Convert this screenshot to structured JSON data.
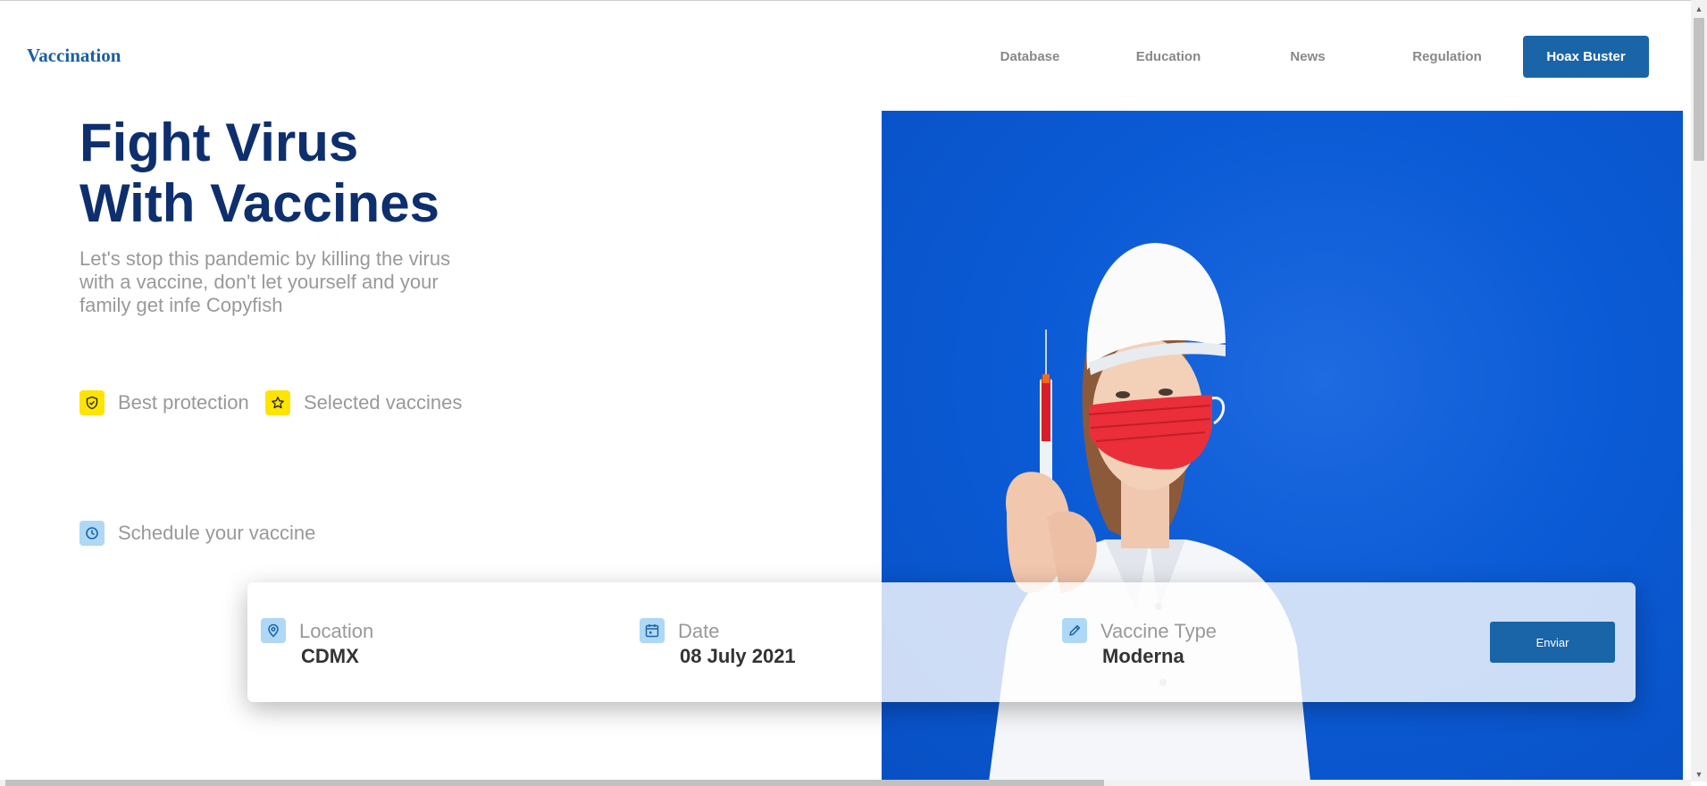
{
  "header": {
    "brand": "Vaccination",
    "nav": [
      "Database",
      "Education",
      "News",
      "Regulation"
    ],
    "cta_label": "Hoax Buster"
  },
  "hero": {
    "title_line1": "Fight Virus",
    "title_line2": "With Vaccines",
    "subtitle": "Let's stop this pandemic by killing the virus with a vaccine, don't let yourself and your family get infe Copyfish",
    "features": [
      {
        "label": "Best protection",
        "icon": "shield-check-icon"
      },
      {
        "label": "Selected vaccines",
        "icon": "star-icon"
      },
      {
        "label": "Schedule your vaccine",
        "icon": "clock-icon"
      }
    ]
  },
  "booking": {
    "location": {
      "label": "Location",
      "value": "CDMX",
      "icon": "map-pin-icon"
    },
    "date": {
      "label": "Date",
      "value": "08 July 2021",
      "icon": "calendar-icon"
    },
    "vaccine": {
      "label": "Vaccine Type",
      "value": "Moderna",
      "icon": "pencil-icon"
    },
    "submit_label": "Enviar"
  },
  "colors": {
    "brand": "#1a5fa3",
    "title": "#0d2f6e",
    "button": "#1a65a8",
    "feature_yellow": "#ffe400",
    "feature_blue": "#aed8f5",
    "photo_bg": "#0b5bd6"
  }
}
